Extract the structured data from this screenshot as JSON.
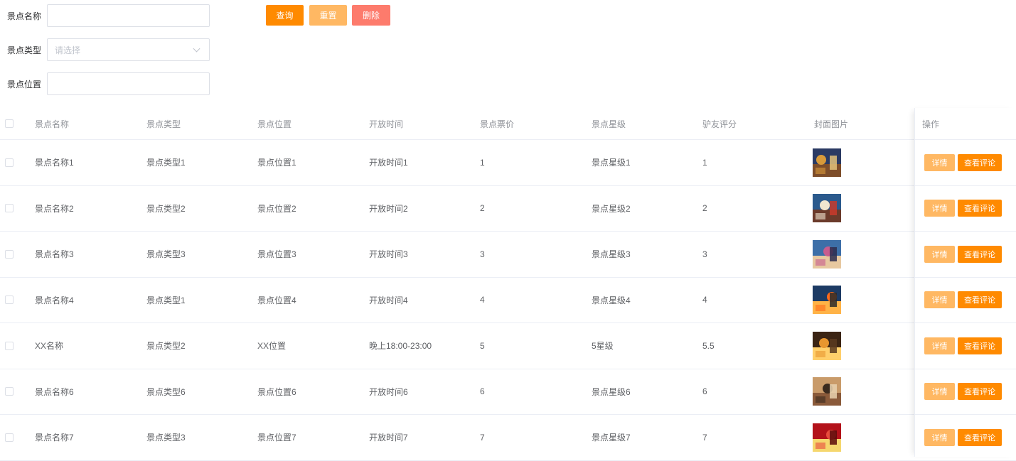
{
  "colors": {
    "query": "#ff8a00",
    "reset": "#ffb863",
    "delete": "#fd7b6c",
    "detail": "#ffb863",
    "comments": "#ff8a00"
  },
  "search": {
    "name_label": "景点名称",
    "name_value": "",
    "type_label": "景点类型",
    "type_placeholder": "请选择",
    "location_label": "景点位置",
    "location_value": ""
  },
  "buttons": {
    "query": "查询",
    "reset": "重置",
    "delete": "删除"
  },
  "table": {
    "headers": [
      "景点名称",
      "景点类型",
      "景点位置",
      "开放时间",
      "景点票价",
      "景点星级",
      "驴友评分",
      "封面图片",
      "操作"
    ],
    "rows": [
      {
        "name": "景点名称1",
        "type": "景点类型1",
        "location": "景点位置1",
        "open_time": "开放时间1",
        "price": "1",
        "star": "景点星级1",
        "rating": "1",
        "cover": "night-market-photo"
      },
      {
        "name": "景点名称2",
        "type": "景点类型2",
        "location": "景点位置2",
        "open_time": "开放时间2",
        "price": "2",
        "star": "景点星级2",
        "rating": "2",
        "cover": "lantern-figure-photo"
      },
      {
        "name": "景点名称3",
        "type": "景点类型3",
        "location": "景点位置3",
        "open_time": "开放时间3",
        "price": "3",
        "star": "景点星级3",
        "rating": "3",
        "cover": "costumed-people-photo"
      },
      {
        "name": "景点名称4",
        "type": "景点类型1",
        "location": "景点位置4",
        "open_time": "开放时间4",
        "price": "4",
        "star": "景点星级4",
        "rating": "4",
        "cover": "fire-breather-photo"
      },
      {
        "name": "XX名称",
        "type": "景点类型2",
        "location": "XX位置",
        "open_time": "晚上18:00-23:00",
        "price": "5",
        "star": "5星级",
        "rating": "5.5",
        "cover": "market-street-photo"
      },
      {
        "name": "景点名称6",
        "type": "景点类型6",
        "location": "景点位置6",
        "open_time": "开放时间6",
        "price": "6",
        "star": "景点星级6",
        "rating": "6",
        "cover": "drum-performance-photo"
      },
      {
        "name": "景点名称7",
        "type": "景点类型3",
        "location": "景点位置7",
        "open_time": "开放时间7",
        "price": "7",
        "star": "景点星级7",
        "rating": "7",
        "cover": "red-stage-photo"
      }
    ],
    "actions": {
      "detail": "详情",
      "comments": "查看评论"
    }
  }
}
